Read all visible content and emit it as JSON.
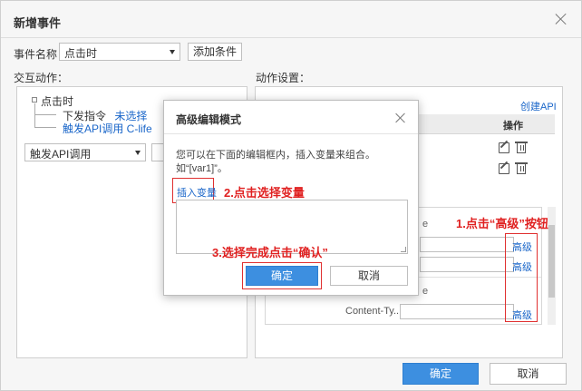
{
  "dialog": {
    "title": "新增事件",
    "event_name_label": "事件名称",
    "event_name_value": "点击时",
    "add_condition_label": "添加条件",
    "interaction_label": "交互动作：",
    "action_settings_label": "动作设置：",
    "create_api_link": "创建API",
    "ok_label": "确定",
    "cancel_label": "取消"
  },
  "tree": {
    "root": "点击时",
    "child1_prefix": "下发指令",
    "child1_status": "未选择",
    "child2": "触发API调用 C-life"
  },
  "left_select": {
    "value": "触发API调用"
  },
  "action_table": {
    "operation_header": "操作",
    "partial_label_1": "e",
    "partial_label_2": "e",
    "content_type_label": "Content-Ty...",
    "advanced_label": "高级"
  },
  "modal": {
    "title": "高级编辑模式",
    "description": "您可以在下面的编辑框内，插入变量来组合。",
    "example": "如“[var1]”。",
    "insert_variable_label": "插入变量",
    "textarea_value": "",
    "ok_label": "确定",
    "cancel_label": "取消"
  },
  "annotations": {
    "step1": "1.点击“高级”按钮",
    "step2": "2.点击选择变量",
    "step3": "3.选择完成点击“确认”"
  },
  "colors": {
    "primary": "#3d8fe0",
    "link": "#1a66c9",
    "annotation": "#e02020"
  }
}
